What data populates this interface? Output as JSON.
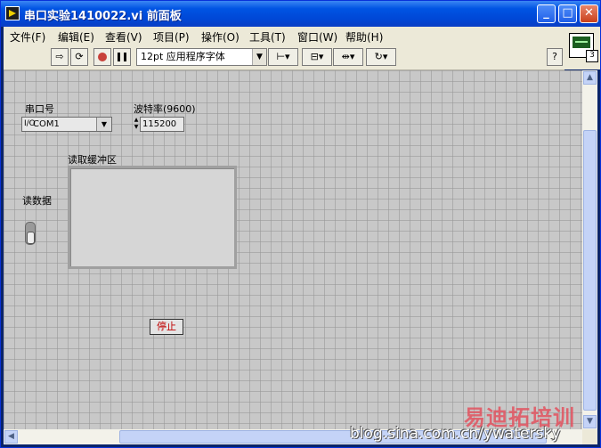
{
  "window": {
    "title": "串口实验1410022.vi 前面板"
  },
  "menu": [
    "文件(F)",
    "编辑(E)",
    "查看(V)",
    "项目(P)",
    "操作(O)",
    "工具(T)",
    "窗口(W)",
    "帮助(H)"
  ],
  "toolbar": {
    "font": "12pt 应用程序字体",
    "help": "?"
  },
  "vi_icon": {
    "number": "3"
  },
  "controls": {
    "port_label": "串口号",
    "port_value": "COM1",
    "port_io": "I/O",
    "baud_label": "波特率(9600)",
    "baud_value": "115200",
    "buffer_label": "读取缓冲区",
    "read_label": "读数据",
    "stop_label": "停止"
  },
  "watermark": {
    "brand": "易迪拓培训",
    "url": "blog.sina.com.cn/ywatersky"
  }
}
